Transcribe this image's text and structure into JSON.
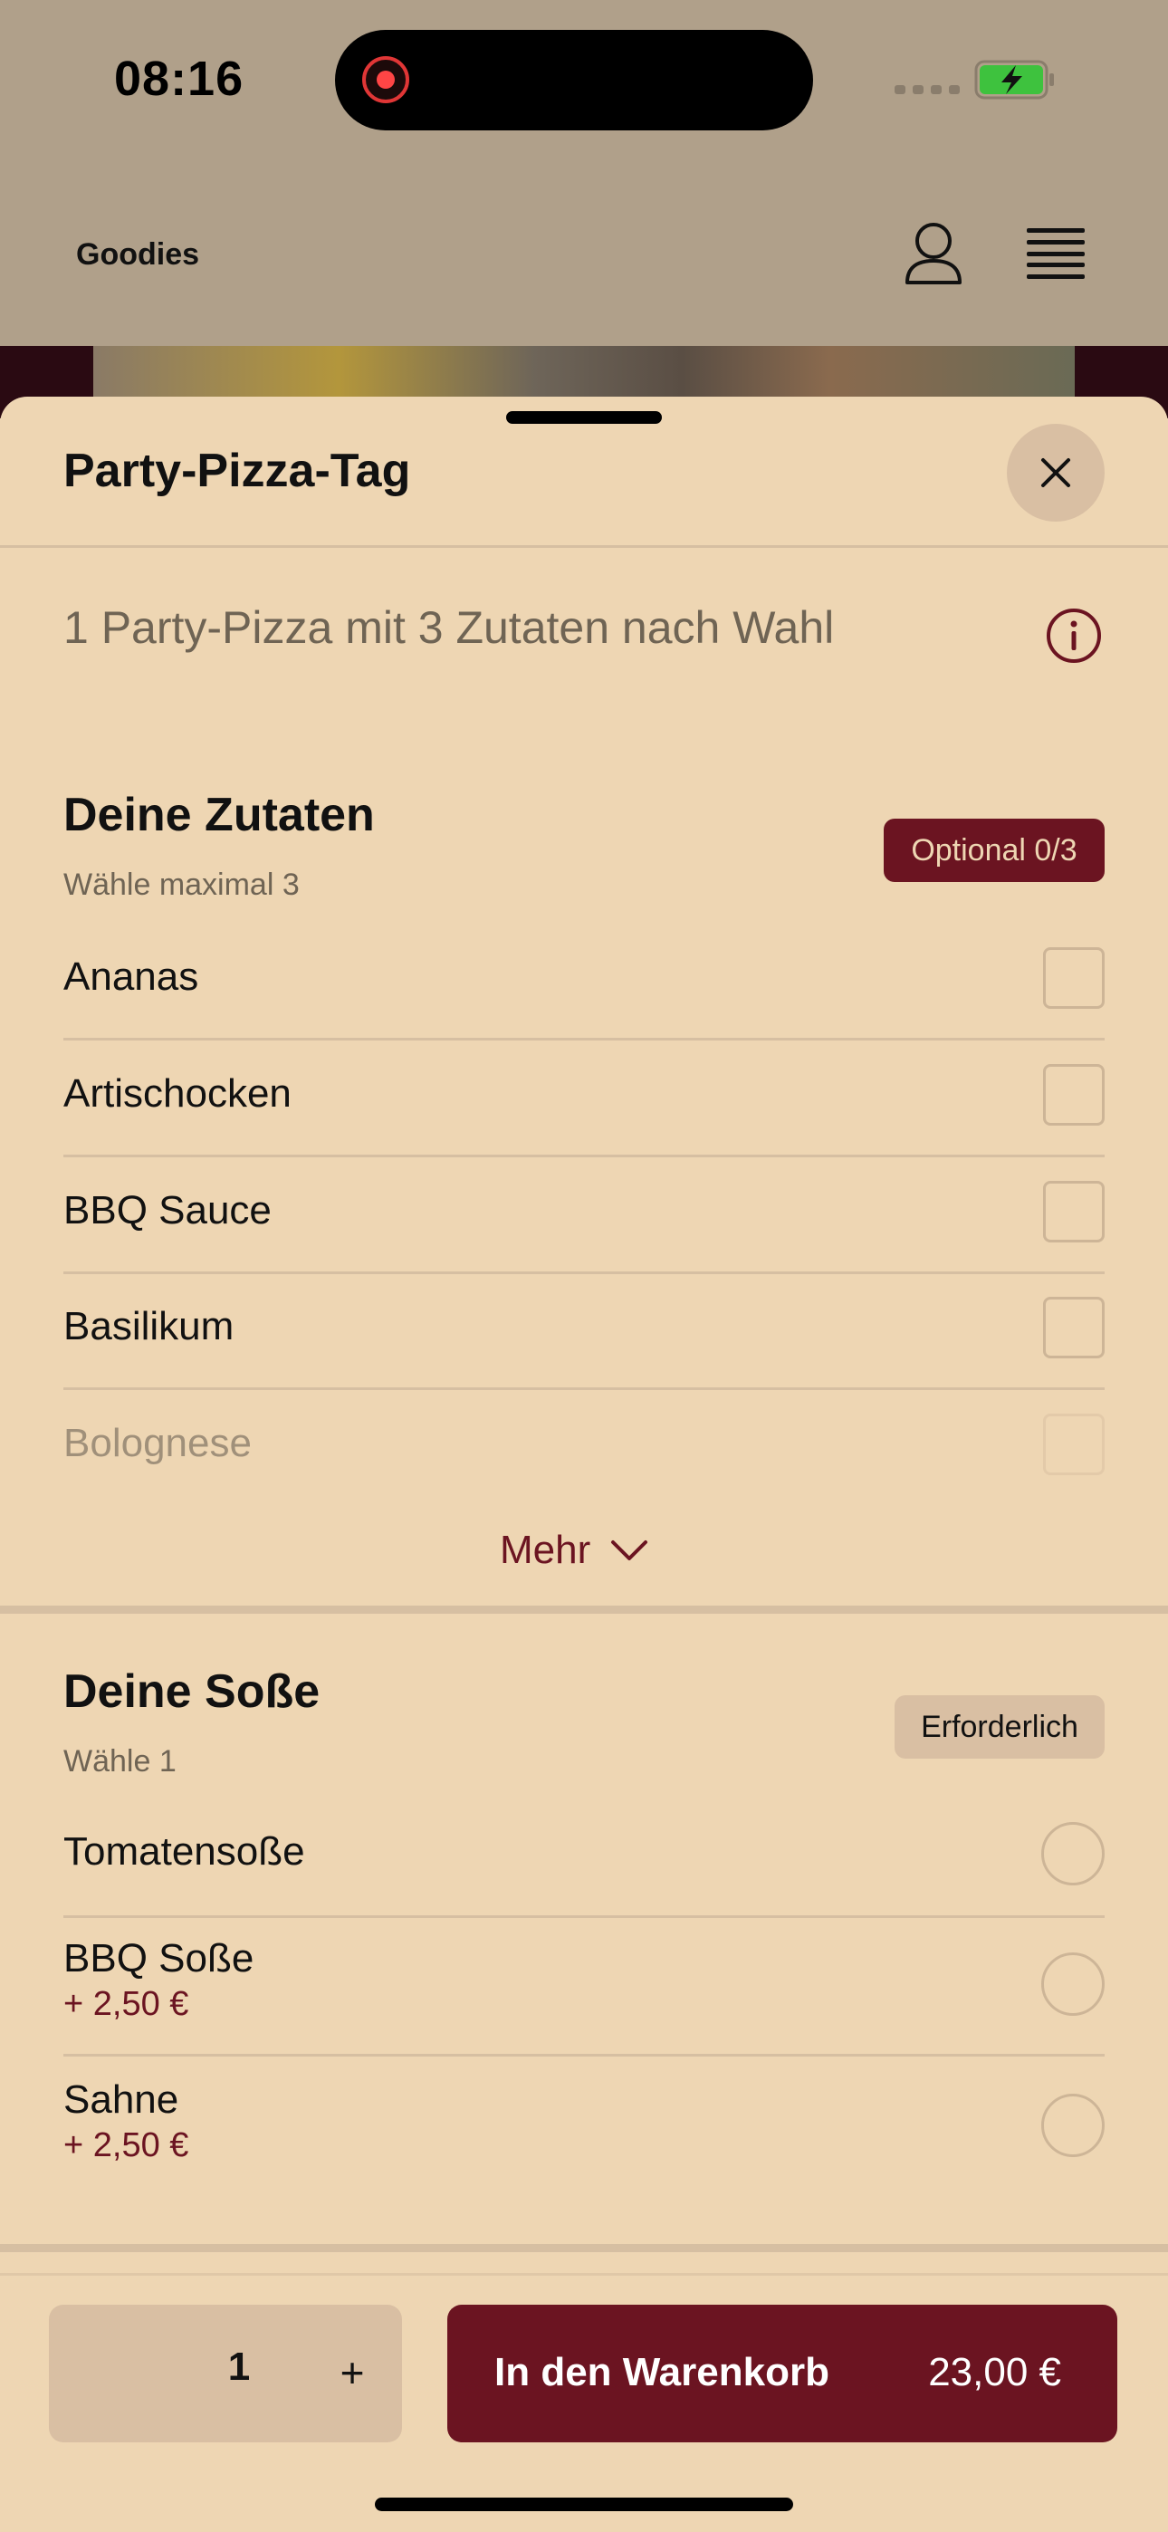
{
  "status": {
    "time": "08:16"
  },
  "header": {
    "title": "Goodies"
  },
  "icons": [
    "record-icon",
    "signal-icon",
    "battery-charging-icon",
    "user-icon",
    "menu-icon",
    "close-icon",
    "info-icon",
    "chevron-down-icon"
  ],
  "sheet": {
    "title": "Party-Pizza-Tag",
    "description": "1 Party-Pizza mit 3 Zutaten nach Wahl"
  },
  "toppings": {
    "title": "Deine Zutaten",
    "subtitle": "Wähle maximal 3",
    "badge": "Optional 0/3",
    "items": [
      {
        "label": "Ananas",
        "checked": false
      },
      {
        "label": "Artischocken",
        "checked": false
      },
      {
        "label": "BBQ Sauce",
        "checked": false
      },
      {
        "label": "Basilikum",
        "checked": false
      },
      {
        "label": "Bolognese",
        "checked": false
      }
    ],
    "more_label": "Mehr"
  },
  "sauce": {
    "title": "Deine Soße",
    "subtitle": "Wähle 1",
    "badge": "Erforderlich",
    "items": [
      {
        "label": "Tomatensoße",
        "price": "",
        "selected": false
      },
      {
        "label": "BBQ Soße",
        "price": "+ 2,50 €",
        "selected": false
      },
      {
        "label": "Sahne",
        "price": "+ 2,50 €",
        "selected": false
      }
    ]
  },
  "bottom": {
    "quantity": "1",
    "plus": "+",
    "cart_label": "In den Warenkorb",
    "cart_price": "23,00 €"
  },
  "colors": {
    "accent": "#6b1421",
    "sheet_bg": "#eed6b3",
    "chip_bg": "#d9bfa3"
  }
}
